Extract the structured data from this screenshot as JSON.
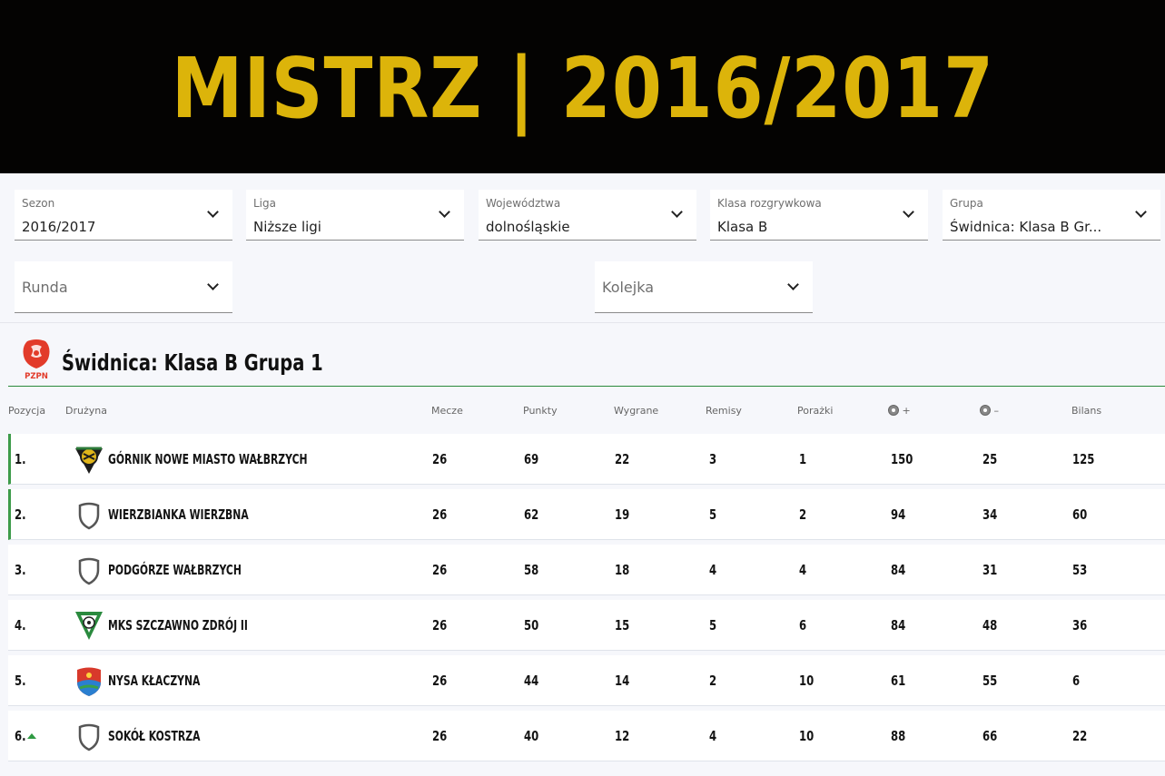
{
  "banner": {
    "title": "MISTRZ | 2016/2017"
  },
  "filters": [
    {
      "label": "Sezon",
      "value": "2016/2017"
    },
    {
      "label": "Liga",
      "value": "Niższe ligi"
    },
    {
      "label": "Województwa",
      "value": "dolnośląskie"
    },
    {
      "label": "Klasa rozgrywkowa",
      "value": "Klasa B"
    },
    {
      "label": "Grupa",
      "value": "Świdnica: Klasa B Gr..."
    }
  ],
  "filters2": [
    {
      "placeholder": "Runda"
    },
    {
      "placeholder": "Kolejka"
    }
  ],
  "league": {
    "logo_text": "PZPN",
    "title": "Świdnica: Klasa B Grupa 1"
  },
  "columns": {
    "pos": "Pozycja",
    "team": "Drużyna",
    "matches": "Mecze",
    "points": "Punkty",
    "wins": "Wygrane",
    "draws": "Remisy",
    "losses": "Porażki",
    "goals_for": "+",
    "goals_against": "–",
    "balance": "Bilans"
  },
  "table": [
    {
      "pos": "1.",
      "team": "GÓRNIK NOWE MIASTO WAŁBRZYCH",
      "crest": "gornik-crest",
      "m": "26",
      "p": "69",
      "w": "22",
      "d": "3",
      "l": "1",
      "gf": "150",
      "ga": "25",
      "b": "125",
      "promo": true
    },
    {
      "pos": "2.",
      "team": "WIERZBIANKA WIERZBNA",
      "crest": "shield-icon",
      "m": "26",
      "p": "62",
      "w": "19",
      "d": "5",
      "l": "2",
      "gf": "94",
      "ga": "34",
      "b": "60",
      "promo": true
    },
    {
      "pos": "3.",
      "team": "PODGÓRZE WAŁBRZYCH",
      "crest": "shield-icon",
      "m": "26",
      "p": "58",
      "w": "18",
      "d": "4",
      "l": "4",
      "gf": "84",
      "ga": "31",
      "b": "53",
      "promo": false
    },
    {
      "pos": "4.",
      "team": "MKS SZCZAWNO ZDRÓJ II",
      "crest": "mks-crest",
      "m": "26",
      "p": "50",
      "w": "15",
      "d": "5",
      "l": "6",
      "gf": "84",
      "ga": "48",
      "b": "36",
      "promo": false
    },
    {
      "pos": "5.",
      "team": "NYSA KŁACZYNA",
      "crest": "nysa-crest",
      "m": "26",
      "p": "44",
      "w": "14",
      "d": "2",
      "l": "10",
      "gf": "61",
      "ga": "55",
      "b": "6",
      "promo": false
    },
    {
      "pos": "6.",
      "team": "SOKÓŁ KOSTRZA",
      "crest": "shield-icon",
      "m": "26",
      "p": "40",
      "w": "12",
      "d": "4",
      "l": "10",
      "gf": "88",
      "ga": "66",
      "b": "22",
      "promo": false,
      "trend": "up"
    }
  ],
  "colors": {
    "banner_bg": "#040302",
    "banner_text": "#dcb40a",
    "promo": "#3d9b4a",
    "trend_up": "#2f9a42"
  }
}
